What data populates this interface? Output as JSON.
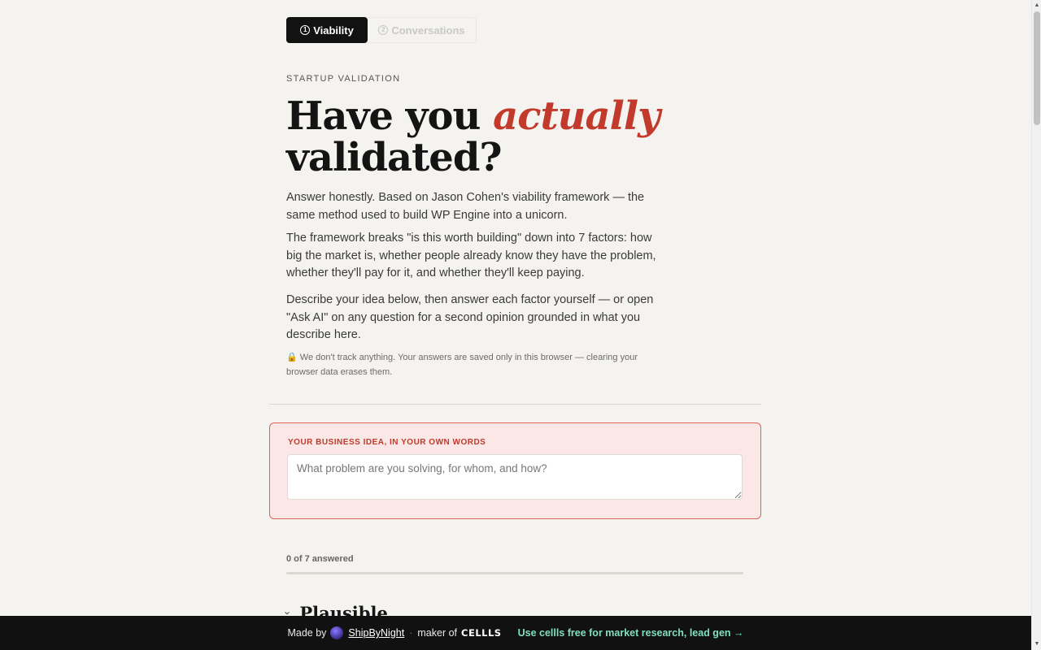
{
  "tabs": [
    {
      "label": "Viability",
      "icon": "1"
    },
    {
      "label": "Conversations",
      "icon": "2"
    }
  ],
  "eyebrow": "STARTUP VALIDATION",
  "headline": {
    "part1": "Have you ",
    "accent": "actually",
    "part2": "validated?"
  },
  "intro": [
    "Answer honestly. Based on Jason Cohen's viability framework — the same method used to build WP Engine into a unicorn.",
    "The framework breaks \"is this worth building\" down into 7 factors: how big the market is, whether people already know they have the problem, whether they'll pay for it, and whether they'll keep paying.",
    "Describe your idea below, then answer each factor yourself — or open \"Ask AI\" on any question for a second opinion grounded in what you describe here."
  ],
  "privacy": {
    "icon": "🔒",
    "text": "We don't track anything. Your answers are saved only in this browser — clearing your browser data erases them."
  },
  "idea": {
    "label": "YOUR BUSINESS IDEA, IN YOUR OWN WORDS",
    "placeholder": "What problem are you solving, for whom, and how?",
    "value": ""
  },
  "progress": {
    "text": "0 of 7 answered",
    "answered": 0,
    "total": 7
  },
  "section": {
    "title": "Plausible"
  },
  "footer": {
    "made_by": "Made by",
    "author": "ShipByNight",
    "sep": "·",
    "maker_of": "maker of",
    "brand": "CELLLS",
    "promo": "Use cellls free for market research, lead gen →"
  },
  "colors": {
    "accent": "#c23a2c",
    "background": "#f5f3ef",
    "footer_bg": "#111111",
    "promo": "#7fe0c0"
  }
}
